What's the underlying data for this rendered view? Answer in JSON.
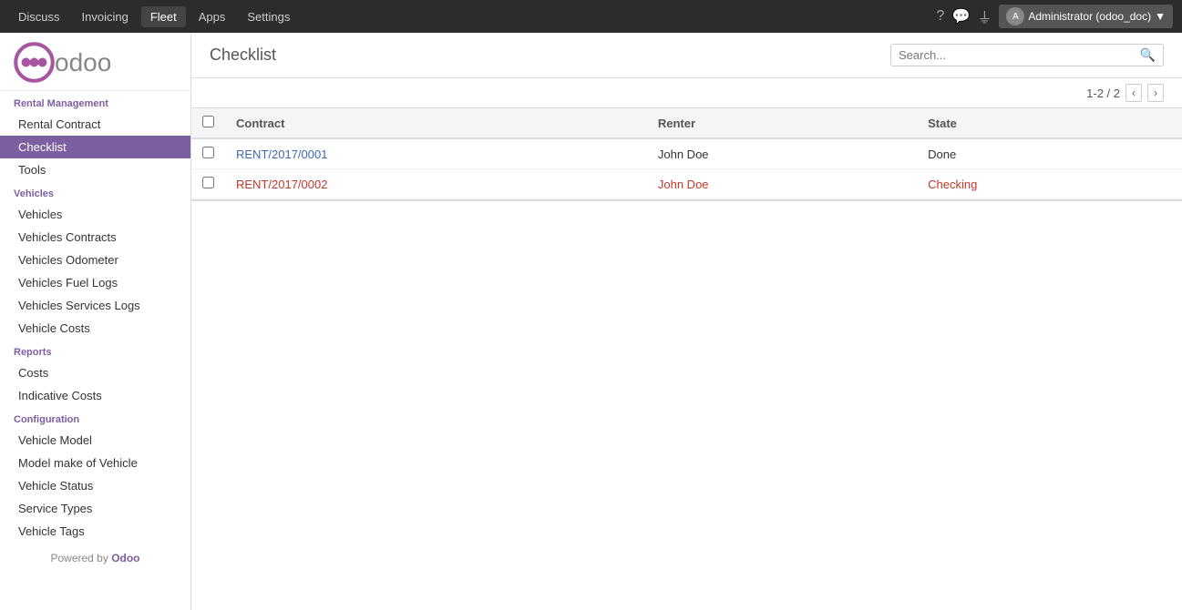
{
  "topNav": {
    "items": [
      "Discuss",
      "Invoicing",
      "Fleet",
      "Apps",
      "Settings"
    ],
    "activeItem": "Fleet",
    "userLabel": "Administrator (odoo_doc)",
    "userInitial": "A"
  },
  "sidebar": {
    "logo": {
      "text": "odoo"
    },
    "sections": [
      {
        "header": "Rental Management",
        "items": [
          {
            "label": "Rental Contract",
            "active": false
          },
          {
            "label": "Checklist",
            "active": true
          },
          {
            "label": "Tools",
            "active": false
          }
        ]
      },
      {
        "header": "Vehicles",
        "items": [
          {
            "label": "Vehicles",
            "active": false
          },
          {
            "label": "Vehicles Contracts",
            "active": false
          },
          {
            "label": "Vehicles Odometer",
            "active": false
          },
          {
            "label": "Vehicles Fuel Logs",
            "active": false
          },
          {
            "label": "Vehicles Services Logs",
            "active": false
          },
          {
            "label": "Vehicle Costs",
            "active": false
          }
        ]
      },
      {
        "header": "Reports",
        "items": [
          {
            "label": "Costs",
            "active": false
          },
          {
            "label": "Indicative Costs",
            "active": false
          }
        ]
      },
      {
        "header": "Configuration",
        "items": [
          {
            "label": "Vehicle Model",
            "active": false
          },
          {
            "label": "Model make of Vehicle",
            "active": false
          },
          {
            "label": "Vehicle Status",
            "active": false
          },
          {
            "label": "Service Types",
            "active": false
          },
          {
            "label": "Vehicle Tags",
            "active": false
          }
        ]
      }
    ],
    "footer": "Powered by Odoo"
  },
  "content": {
    "title": "Checklist",
    "search": {
      "placeholder": "Search..."
    },
    "pagination": {
      "current": "1-2 / 2"
    },
    "table": {
      "columns": [
        "Contract",
        "Renter",
        "State"
      ],
      "rows": [
        {
          "contract": "RENT/2017/0001",
          "renter": "John Doe",
          "state": "Done",
          "style": "done"
        },
        {
          "contract": "RENT/2017/0002",
          "renter": "John Doe",
          "state": "Checking",
          "style": "checking"
        }
      ]
    }
  }
}
